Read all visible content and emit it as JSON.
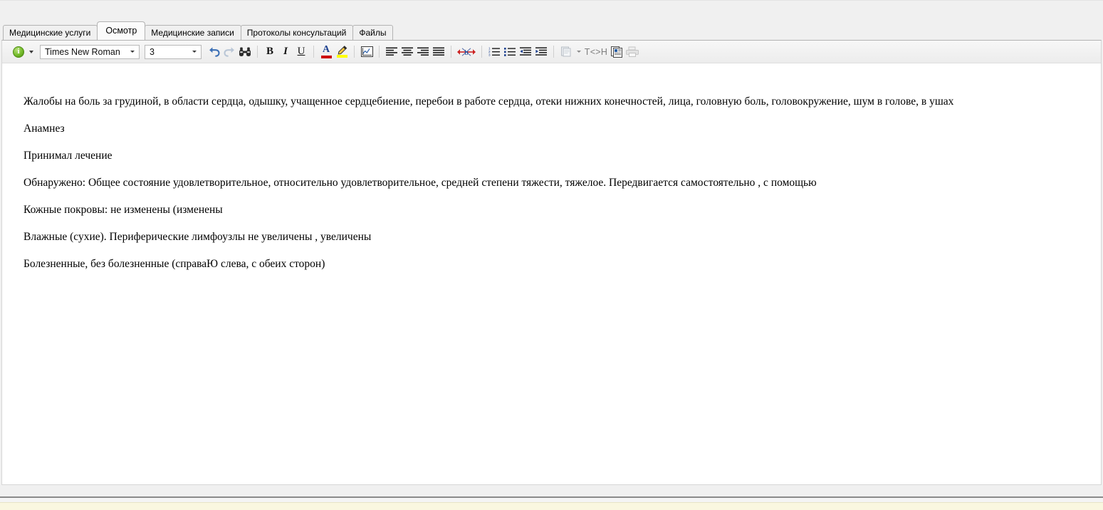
{
  "tabs": [
    {
      "label": "Медицинские услуги",
      "selected": false
    },
    {
      "label": "Осмотр",
      "selected": true
    },
    {
      "label": "Медицинские записи",
      "selected": false
    },
    {
      "label": "Протоколы консультаций",
      "selected": false
    },
    {
      "label": "Файлы",
      "selected": false
    }
  ],
  "toolbar": {
    "info_icon": "info-icon",
    "info_dropdown_icon": "chevron-down-icon",
    "font_family": {
      "value": "Times New Roman",
      "icon": "chevron-down-icon"
    },
    "font_size": {
      "value": "3",
      "icon": "chevron-down-icon"
    },
    "buttons": [
      {
        "name": "undo-button",
        "icon": "undo-arrow-icon",
        "title": "Отменить"
      },
      {
        "name": "redo-button",
        "icon": "redo-arrow-icon",
        "title": "Повторить"
      },
      {
        "name": "find-button",
        "icon": "binoculars-icon",
        "title": "Найти"
      },
      {
        "name": "bold-button",
        "icon": "bold-icon",
        "title": "Полужирный",
        "label": "B"
      },
      {
        "name": "italic-button",
        "icon": "italic-icon",
        "title": "Курсив",
        "label": "I"
      },
      {
        "name": "underline-button",
        "icon": "underline-icon",
        "title": "Подчёркнутый",
        "label": "U"
      },
      {
        "name": "font-color-button",
        "icon": "text-color-icon",
        "title": "Цвет текста",
        "label": "A"
      },
      {
        "name": "highlight-button",
        "icon": "highlighter-pen-icon",
        "title": "Цвет выделения"
      },
      {
        "name": "insert-chart-button",
        "icon": "chart-image-icon",
        "title": "Вставить изображение"
      },
      {
        "name": "align-left-button",
        "icon": "align-left-icon",
        "title": "По левому краю"
      },
      {
        "name": "align-center-button",
        "icon": "align-center-icon",
        "title": "По центру"
      },
      {
        "name": "align-right-button",
        "icon": "align-right-icon",
        "title": "По правому краю"
      },
      {
        "name": "align-justify-button",
        "icon": "align-justify-icon",
        "title": "По ширине"
      },
      {
        "name": "insert-link-button",
        "icon": "link-arrows-icon",
        "title": "Вставить ссылку"
      },
      {
        "name": "numbered-list-button",
        "icon": "ordered-list-icon",
        "title": "Нумерованный список"
      },
      {
        "name": "bulleted-list-button",
        "icon": "unordered-list-icon",
        "title": "Маркированный список"
      },
      {
        "name": "decrease-indent-button",
        "icon": "outdent-icon",
        "title": "Уменьшить отступ"
      },
      {
        "name": "increase-indent-button",
        "icon": "indent-icon",
        "title": "Увеличить отступ"
      },
      {
        "name": "template-button",
        "icon": "document-stack-icon",
        "title": "Шаблон"
      },
      {
        "name": "template-dropdown-button",
        "icon": "chevron-down-icon"
      },
      {
        "name": "source-view-button",
        "icon": "html-source-icon",
        "label": "T<>H",
        "title": "Исходный код"
      },
      {
        "name": "copy-block-button",
        "icon": "copy-document-icon",
        "title": "Копировать"
      },
      {
        "name": "print-button",
        "icon": "printer-icon",
        "title": "Печать"
      }
    ]
  },
  "document": {
    "paragraphs": [
      "Жалобы на боль за грудиной, в области сердца, одышку, учащенное сердцебиение, перебои в работе сердца, отеки нижних конечностей, лица, головную боль, головокружение, шум в голове, в ушах",
      "Анамнез",
      "Принимал лечение",
      "Обнаружено: Общее состояние удовлетворительное, относительно удовлетворительное, средней степени тяжести, тяжелое. Передвигается самостоятельно , с помощью",
      "Кожные покровы: не изменены (изменены",
      "Влажные (сухие). Периферические лимфоузлы не увеличены , увеличены",
      "Болезненные, без болезненные (справаЮ слева, с обеих сторон)"
    ]
  },
  "colors": {
    "accent_red": "#cc0000",
    "accent_blue": "#1b3f8f",
    "highlight_yellow": "#ffff00",
    "info_green": "#74bb2a",
    "status_bar": "#faf7e0",
    "panel_bg": "#ffffff",
    "chrome_bg": "#f0f0f0"
  }
}
